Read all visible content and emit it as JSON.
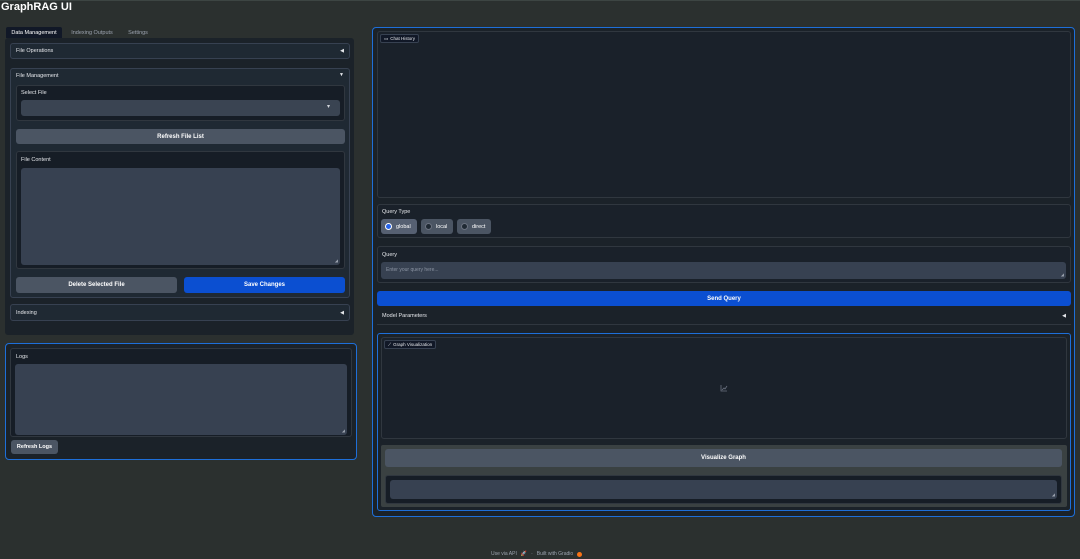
{
  "app": {
    "title": "GraphRAG UI"
  },
  "tabs": [
    {
      "label": "Data Management",
      "active": true
    },
    {
      "label": "Indexing Outputs",
      "active": false
    },
    {
      "label": "Settings",
      "active": false
    }
  ],
  "left": {
    "file_operations": {
      "label": "File Operations",
      "arrow": "◀"
    },
    "file_management": {
      "label": "File Management",
      "arrow": "▼",
      "select_label": "Select File",
      "select_value": "",
      "select_arrow": "▾",
      "refresh_button": "Refresh File List",
      "content_label": "File Content",
      "content_value": "",
      "delete_button": "Delete Selected File",
      "save_button": "Save Changes"
    },
    "indexing": {
      "label": "Indexing",
      "arrow": "◀"
    },
    "logs": {
      "label": "Logs",
      "value": "",
      "refresh_button": "Refresh Logs"
    }
  },
  "right": {
    "chat_history": {
      "label": "Chat History",
      "icon": "chat-icon"
    },
    "query_type": {
      "label": "Query Type",
      "options": [
        "global",
        "local",
        "direct"
      ],
      "selected": "global"
    },
    "query": {
      "label": "Query",
      "placeholder": "Enter your query here..."
    },
    "send_button": "Send Query",
    "model_parameters": {
      "label": "Model Parameters",
      "arrow": "◀"
    },
    "graph": {
      "label": "Graph Visualization",
      "icon": "chart-icon",
      "visualize_button": "Visualize Graph",
      "output_value": ""
    }
  },
  "footer": {
    "api_text": "Use via API",
    "separator": "·",
    "built_text": "Built with Gradio"
  },
  "colors": {
    "accent": "#0b4fd1",
    "focus_border": "#1e6fd9",
    "background": "#2b302f",
    "panel": "#1f2933"
  }
}
